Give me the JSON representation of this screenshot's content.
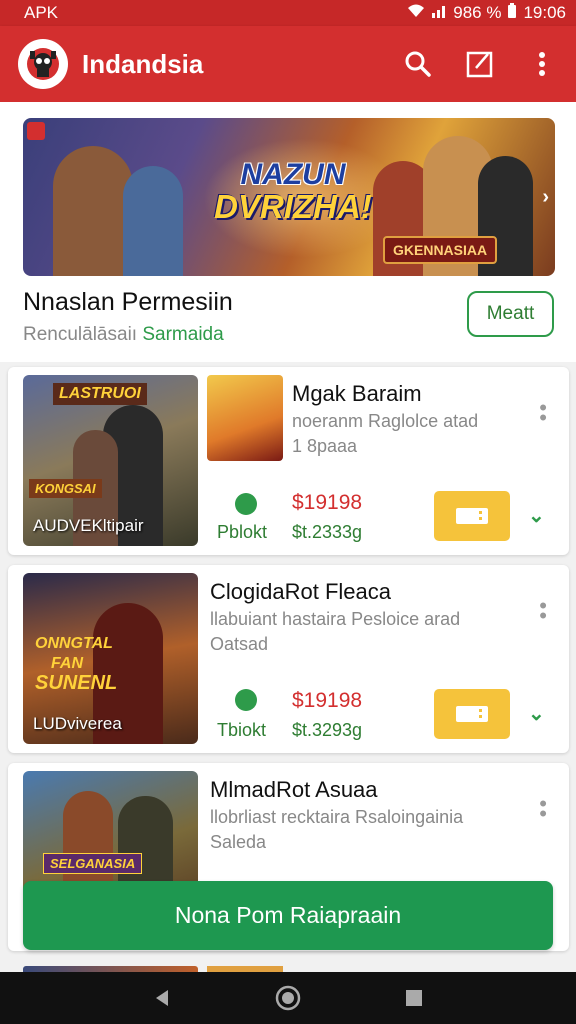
{
  "status_bar": {
    "left": "APK",
    "battery": "986 %",
    "time": "19:06"
  },
  "app_bar": {
    "title": "Indandsia",
    "icons": [
      "search-icon",
      "edit-square-icon",
      "more-vertical-icon"
    ]
  },
  "featured": {
    "banner_line1": "NAZUN",
    "banner_line2": "DVRIZHA!",
    "banner_tag": "GKENNASIAA",
    "title": "Nnaslan Permesiin",
    "subtitle_gray": "Renculālāsaiı",
    "subtitle_green": "Sarmaida",
    "button": "Meatt"
  },
  "items": [
    {
      "thumb_plate": "LASTRUOI",
      "thumb_plate2": "KONGSAI",
      "thumb_caption": "AUDVEKltipair",
      "title": "Mgak Baraim",
      "desc_line1": "noeranm Raglolce atad",
      "desc_line2": "1 8paaa",
      "meta_label": "Pblokt",
      "price": "$19198",
      "price_sub": "$t.2333g"
    },
    {
      "thumb_plate": "ONNGTAL",
      "thumb_plate2": "FAN",
      "thumb_plate3": "SUNENL",
      "thumb_caption": "LUDviverea",
      "title": "ClogidaRot Fleaca",
      "desc_line1": "llabuiant  hastaira Pesloice arad",
      "desc_line2": "Oatsad",
      "meta_label": "Tbiokt",
      "price": "$19198",
      "price_sub": "$t.3293g"
    },
    {
      "thumb_plate": "SELGANASIA",
      "title": "MlmadRot Asuaa",
      "desc_line1": "llobrliast  recktaira Rsaloingainia",
      "desc_line2": "Saleda"
    }
  ],
  "cta": {
    "label": "Nona Pom Raiapraain"
  },
  "colors": {
    "primary": "#d32f2f",
    "green": "#1e9850",
    "yellow": "#f5c33b"
  }
}
